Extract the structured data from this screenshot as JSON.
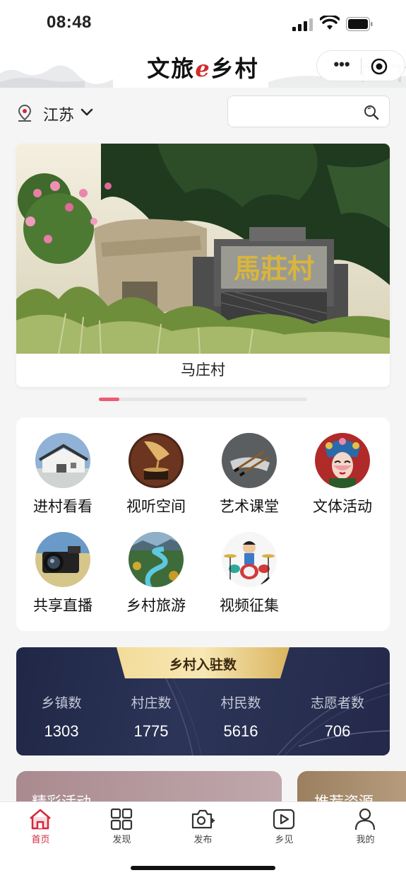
{
  "status_bar": {
    "time": "08:48"
  },
  "navbar": {
    "title_part1": "文旅",
    "title_e": "e",
    "title_part2": "乡村"
  },
  "location": {
    "region": "江苏"
  },
  "search": {
    "placeholder": ""
  },
  "banner": {
    "caption": "马庄村",
    "sign_text": "馬莊村"
  },
  "features": [
    {
      "label": "进村看看",
      "icon": "village-icon"
    },
    {
      "label": "视听空间",
      "icon": "gramophone-icon"
    },
    {
      "label": "艺术课堂",
      "icon": "calligraphy-brush-icon"
    },
    {
      "label": "文体活动",
      "icon": "opera-mask-icon"
    },
    {
      "label": "共享直播",
      "icon": "camera-icon"
    },
    {
      "label": "乡村旅游",
      "icon": "river-landscape-icon"
    },
    {
      "label": "视频征集",
      "icon": "drummer-icon"
    }
  ],
  "stats": {
    "title": "乡村入驻数",
    "items": [
      {
        "label": "乡镇数",
        "value": "1303"
      },
      {
        "label": "村庄数",
        "value": "1775"
      },
      {
        "label": "村民数",
        "value": "5616"
      },
      {
        "label": "志愿者数",
        "value": "706"
      }
    ]
  },
  "sections": {
    "activity_title": "精彩活动",
    "resource_title": "推荐资源"
  },
  "tabbar": [
    {
      "label": "首页",
      "icon": "home-icon",
      "active": true
    },
    {
      "label": "发现",
      "icon": "grid-icon",
      "active": false
    },
    {
      "label": "发布",
      "icon": "camera-plus-icon",
      "active": false
    },
    {
      "label": "乡见",
      "icon": "video-play-icon",
      "active": false
    },
    {
      "label": "我的",
      "icon": "user-icon",
      "active": false
    }
  ],
  "colors": {
    "accent": "#d6273b",
    "indicator": "#ee5a73",
    "stats_bg": "#24294a",
    "stats_tab": "#e6c97a"
  }
}
